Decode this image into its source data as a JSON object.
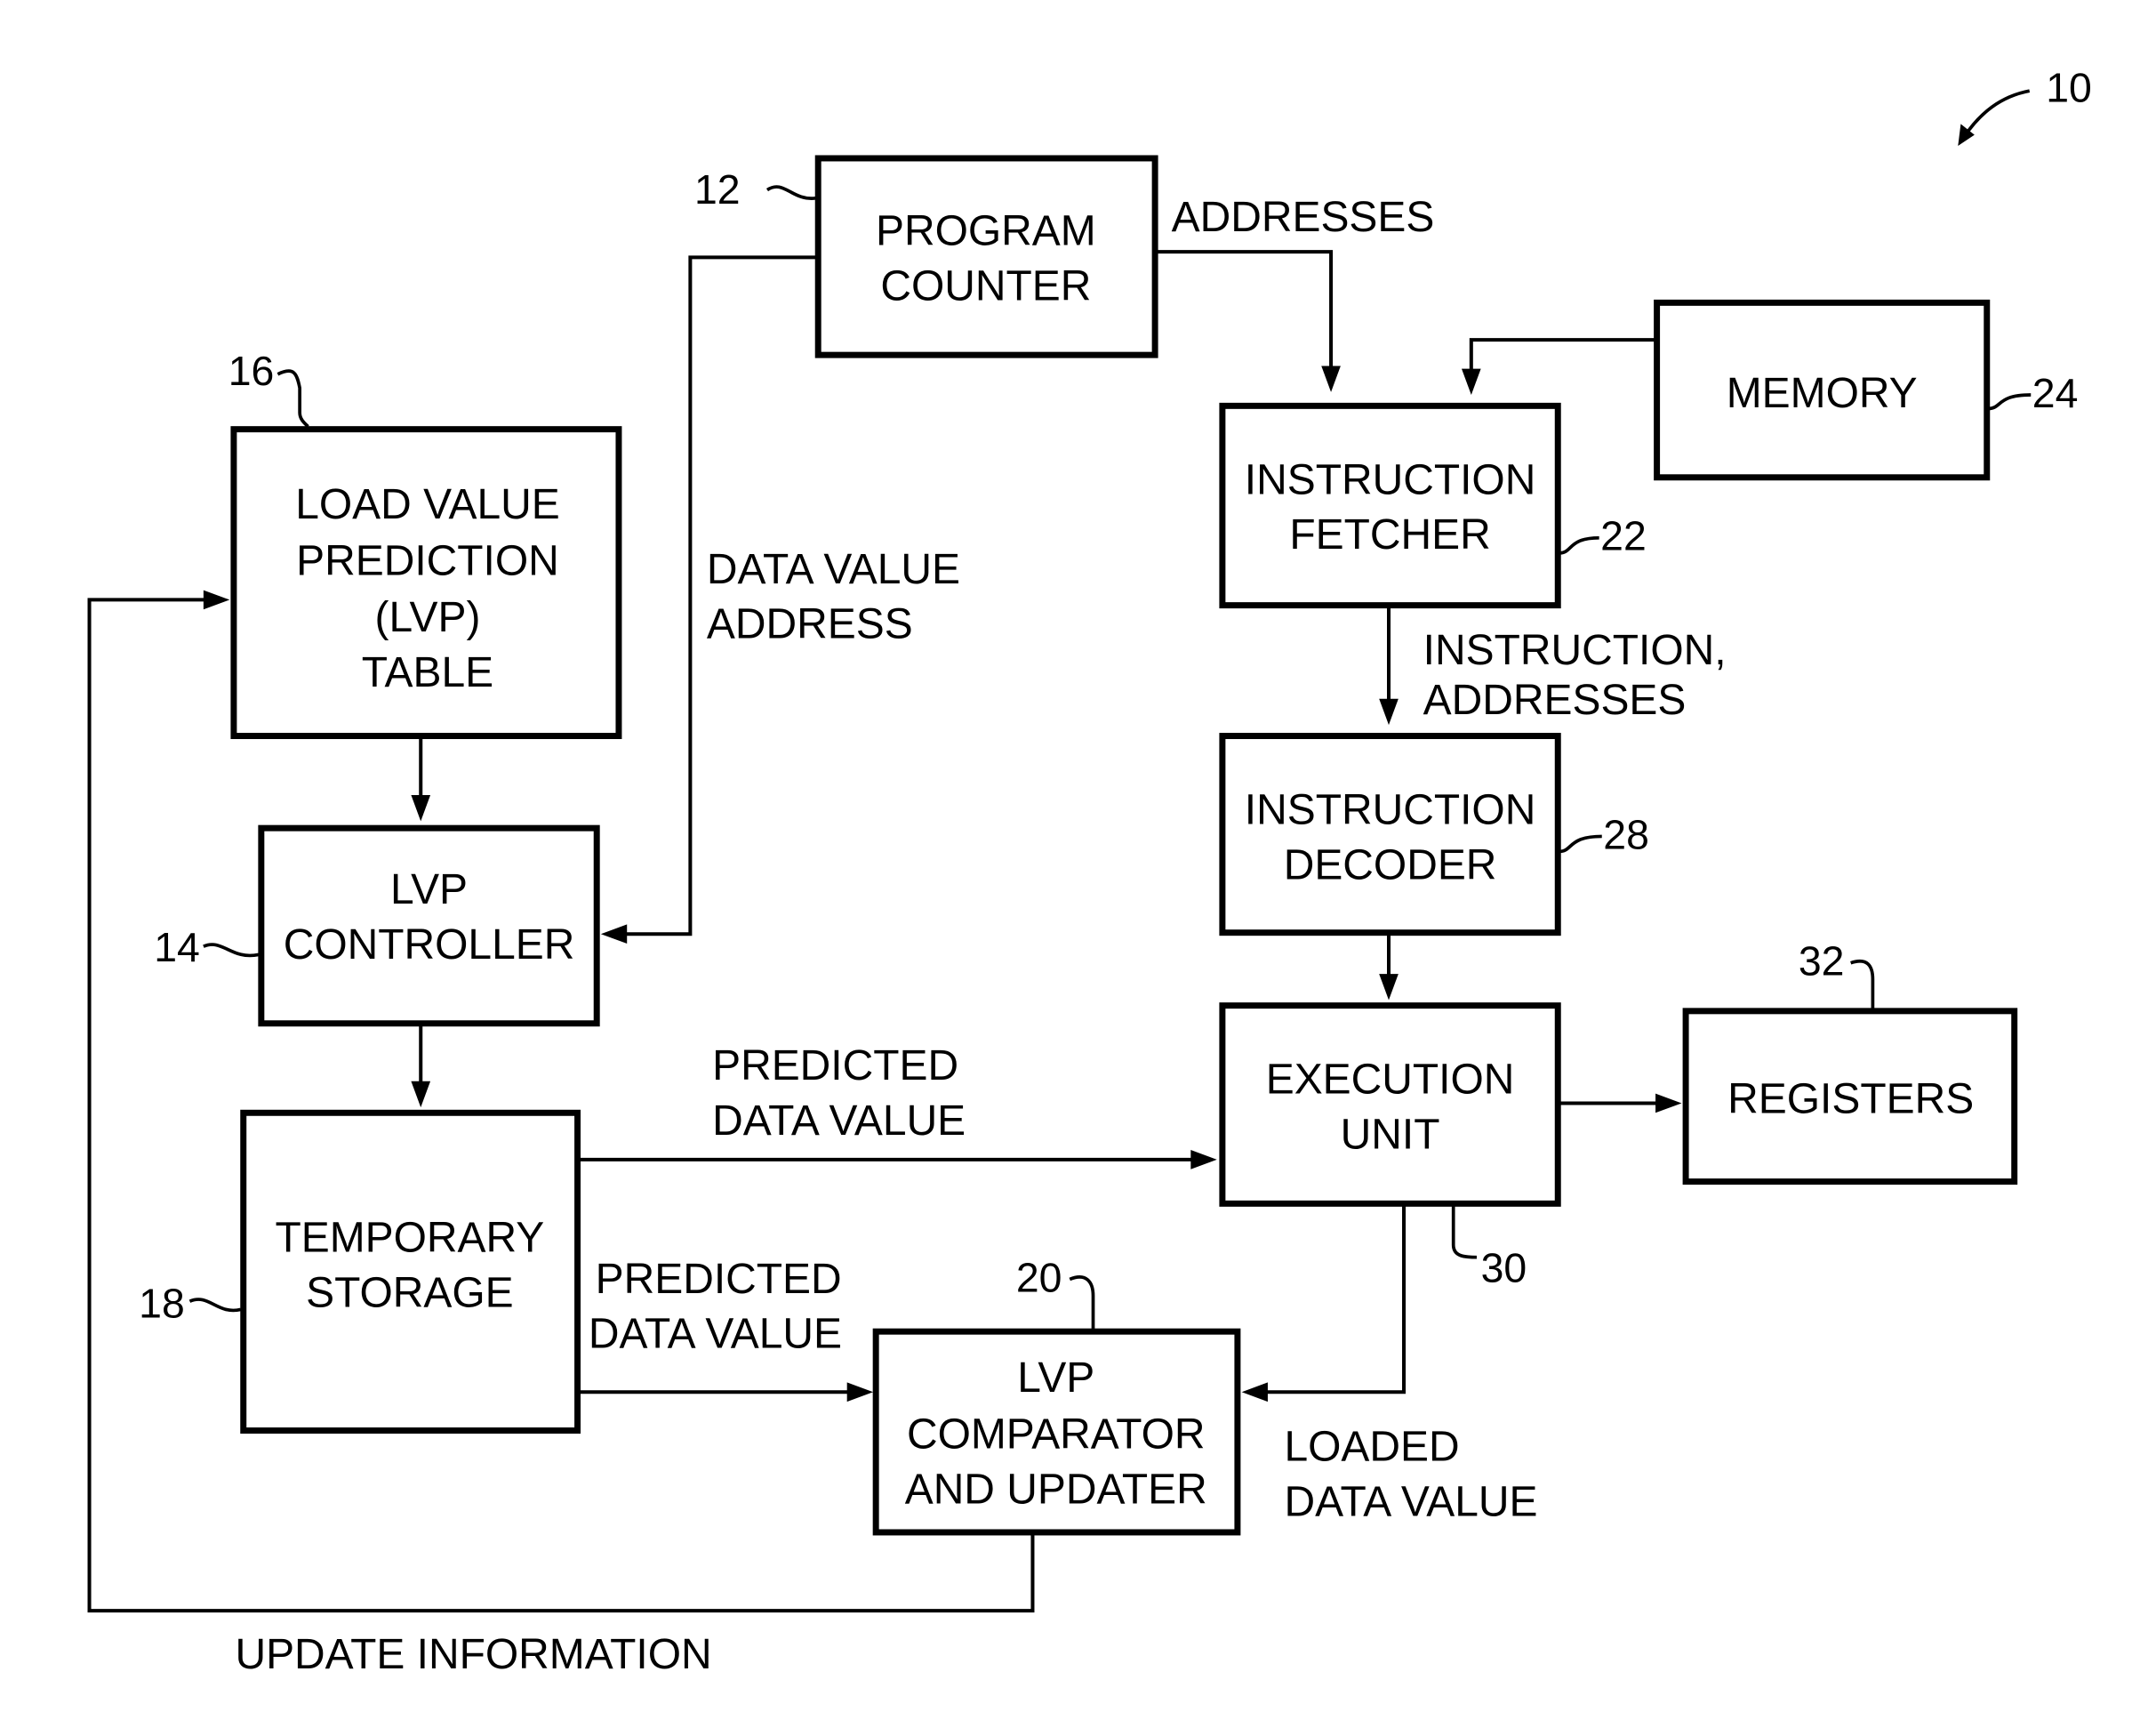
{
  "figure": {
    "ref": "10",
    "blocks": {
      "program_counter": {
        "ref": "12",
        "lines": [
          "PROGRAM",
          "COUNTER"
        ]
      },
      "memory": {
        "ref": "24",
        "lines": [
          "MEMORY"
        ]
      },
      "instruction_fetcher": {
        "ref": "22",
        "lines": [
          "INSTRUCTION",
          "FETCHER"
        ]
      },
      "lvp_table": {
        "ref": "16",
        "lines": [
          "LOAD VALUE",
          "PREDICTION",
          "(LVP)",
          "TABLE"
        ]
      },
      "lvp_controller": {
        "ref": "14",
        "lines": [
          "LVP",
          "CONTROLLER"
        ]
      },
      "instruction_decoder": {
        "ref": "28",
        "lines": [
          "INSTRUCTION",
          "DECODER"
        ]
      },
      "execution_unit": {
        "ref": "30",
        "lines": [
          "EXECUTION",
          "UNIT"
        ]
      },
      "registers": {
        "ref": "32",
        "lines": [
          "REGISTERS"
        ]
      },
      "temporary_storage": {
        "ref": "18",
        "lines": [
          "TEMPORARY",
          "STORAGE"
        ]
      },
      "lvp_comparator": {
        "ref": "20",
        "lines": [
          "LVP",
          "COMPARATOR",
          "AND UPDATER"
        ]
      }
    },
    "edge_labels": {
      "addresses": [
        "ADDRESSES"
      ],
      "data_value_address": [
        "DATA VALUE",
        "ADDRESS"
      ],
      "instruction_addresses": [
        "INSTRUCTION,",
        "ADDRESSES"
      ],
      "predicted_to_exec": [
        "PREDICTED",
        "DATA VALUE"
      ],
      "predicted_to_comp": [
        "PREDICTED",
        "DATA VALUE"
      ],
      "loaded_data_value": [
        "LOADED",
        "DATA VALUE"
      ],
      "update_information": [
        "UPDATE INFORMATION"
      ]
    }
  }
}
